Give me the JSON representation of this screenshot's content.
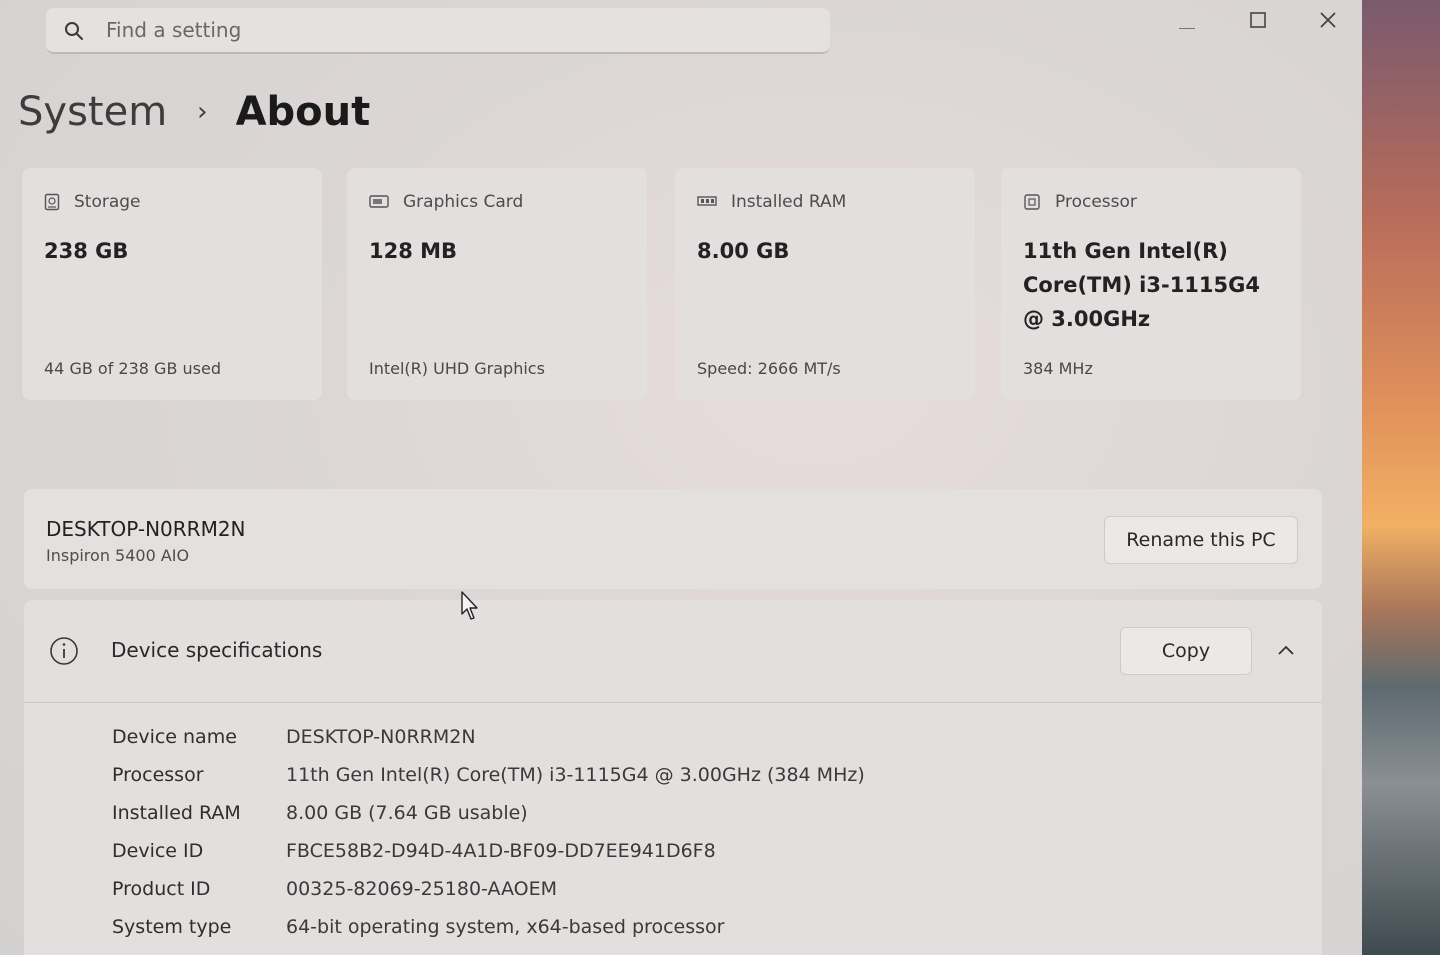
{
  "search": {
    "placeholder": "Find a setting"
  },
  "window_controls": {
    "minimize": "minimize",
    "maximize": "maximize",
    "close": "close"
  },
  "breadcrumb": {
    "parent": "System",
    "separator": "›",
    "current": "About"
  },
  "cards": [
    {
      "label": "Storage",
      "value": "238 GB",
      "sub": "44 GB of 238 GB used",
      "icon": "storage-icon"
    },
    {
      "label": "Graphics Card",
      "value": "128 MB",
      "sub": "Intel(R) UHD Graphics",
      "icon": "graphics-card-icon"
    },
    {
      "label": "Installed RAM",
      "value": "8.00 GB",
      "sub": "Speed: 2666 MT/s",
      "icon": "ram-icon"
    },
    {
      "label": "Processor",
      "value": "11th Gen Intel(R) Core(TM) i3-1115G4 @ 3.00GHz",
      "sub": "384 MHz",
      "icon": "processor-icon"
    }
  ],
  "pc": {
    "name": "DESKTOP-N0RRM2N",
    "model": "Inspiron 5400 AIO",
    "rename_label": "Rename this PC"
  },
  "specs": {
    "title": "Device specifications",
    "copy_label": "Copy",
    "rows": [
      {
        "label": "Device name",
        "value": "DESKTOP-N0RRM2N"
      },
      {
        "label": "Processor",
        "value": "11th Gen Intel(R) Core(TM) i3-1115G4 @ 3.00GHz (384 MHz)"
      },
      {
        "label": "Installed RAM",
        "value": "8.00 GB (7.64 GB usable)"
      },
      {
        "label": "Device ID",
        "value": "FBCE58B2-D94D-4A1D-BF09-DD7EE941D6F8"
      },
      {
        "label": "Product ID",
        "value": "00325-82069-25180-AAOEM"
      },
      {
        "label": "System type",
        "value": "64-bit operating system, x64-based processor"
      }
    ]
  }
}
